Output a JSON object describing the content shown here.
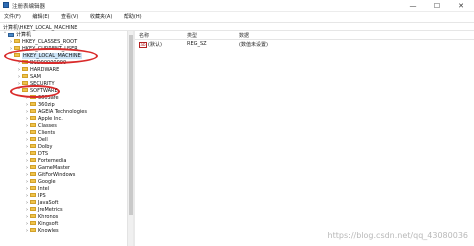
{
  "window": {
    "title": "注册表编辑器",
    "minimize_glyph": "—",
    "maximize_glyph": "☐",
    "close_glyph": "✕"
  },
  "menu": [
    "文件(F)",
    "编辑(E)",
    "查看(V)",
    "收藏夹(A)",
    "帮助(H)"
  ],
  "address": "计算机\\HKEY_LOCAL_MACHINE",
  "tree": {
    "root": "计算机",
    "items": [
      {
        "label": "HKEY_CLASSES_ROOT",
        "chev": "›"
      },
      {
        "label": "HKEY_CURRENT_USER",
        "chev": "›"
      },
      {
        "label": "HKEY_LOCAL_MACHINE",
        "chev": "˅"
      },
      {
        "label": "BCD00000000",
        "chev": "›"
      },
      {
        "label": "HARDWARE",
        "chev": "›"
      },
      {
        "label": "SAM",
        "chev": "›"
      },
      {
        "label": "SECURITY",
        "chev": "›"
      },
      {
        "label": "SOFTWARE",
        "chev": "˅"
      },
      {
        "label": "360Safe",
        "chev": "›"
      },
      {
        "label": "360zip",
        "chev": "›"
      },
      {
        "label": "AGEIA Technologies",
        "chev": "›"
      },
      {
        "label": "Apple Inc.",
        "chev": "›"
      },
      {
        "label": "Classes",
        "chev": "›"
      },
      {
        "label": "Clients",
        "chev": "›"
      },
      {
        "label": "Dell",
        "chev": "›"
      },
      {
        "label": "Dolby",
        "chev": "›"
      },
      {
        "label": "DTS",
        "chev": "›"
      },
      {
        "label": "Fortemedia",
        "chev": "›"
      },
      {
        "label": "GameMaster",
        "chev": "›"
      },
      {
        "label": "GitForWindows",
        "chev": "›"
      },
      {
        "label": "Google",
        "chev": "›"
      },
      {
        "label": "Intel",
        "chev": "›"
      },
      {
        "label": "IPS",
        "chev": "›"
      },
      {
        "label": "JavaSoft",
        "chev": "›"
      },
      {
        "label": "JreMetrics",
        "chev": "›"
      },
      {
        "label": "Khronos",
        "chev": "›"
      },
      {
        "label": "Kingsoft",
        "chev": "›"
      },
      {
        "label": "Knowles",
        "chev": "›"
      }
    ]
  },
  "list": {
    "columns": [
      "名称",
      "类型",
      "数据"
    ],
    "rows": [
      {
        "name": "(默认)",
        "type": "REG_SZ",
        "data": "(数值未设置)"
      }
    ]
  },
  "watermark": "https://blog.csdn.net/qq_43080036",
  "colors": {
    "annotation": "#d92a2a",
    "selection": "#cce4f7",
    "folder": "#f0c34a"
  }
}
